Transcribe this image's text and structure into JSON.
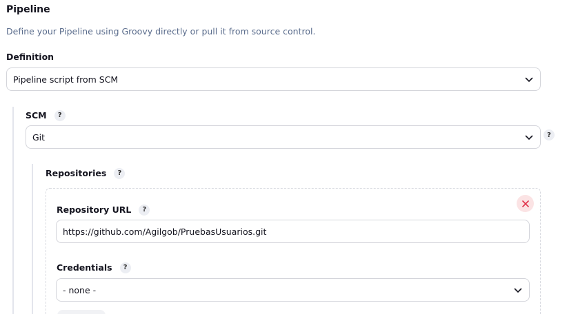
{
  "pipeline": {
    "title": "Pipeline",
    "description": "Define your Pipeline using Groovy directly or pull it from source control.",
    "definition_label": "Definition",
    "definition_value": "Pipeline script from SCM"
  },
  "scm": {
    "label": "SCM",
    "help": "?",
    "value": "Git",
    "side_help": "?"
  },
  "repositories": {
    "label": "Repositories",
    "help": "?",
    "url_label": "Repository URL",
    "url_help": "?",
    "url_value": "https://github.com/Agilgob/PruebasUsuarios.git",
    "credentials_label": "Credentials",
    "credentials_help": "?",
    "credentials_value": "- none -"
  },
  "colors": {
    "close_icon": "#e0324a",
    "chevron": "#14141f"
  }
}
